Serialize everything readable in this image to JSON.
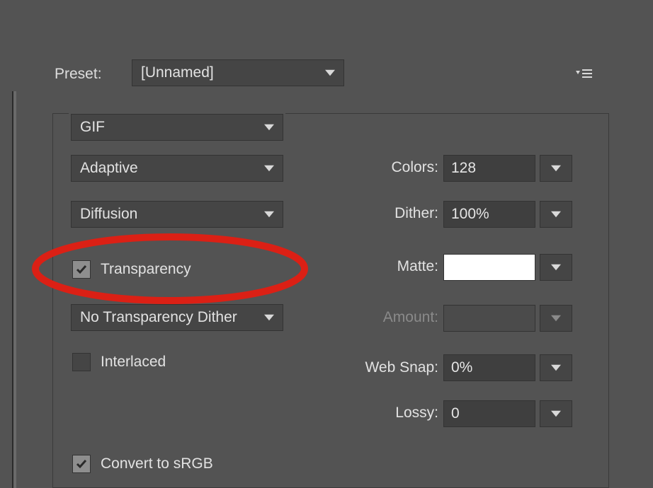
{
  "preset": {
    "label": "Preset:",
    "value": "[Unnamed]"
  },
  "format": {
    "value": "GIF"
  },
  "colorAlgo": {
    "value": "Adaptive"
  },
  "ditherAlgo": {
    "value": "Diffusion"
  },
  "transparency": {
    "label": "Transparency",
    "checked": true
  },
  "transparencyDither": {
    "value": "No Transparency Dither"
  },
  "interlaced": {
    "label": "Interlaced",
    "checked": false
  },
  "convertSrgb": {
    "label": "Convert to sRGB",
    "checked": true
  },
  "colors": {
    "label": "Colors:",
    "value": "128"
  },
  "dither": {
    "label": "Dither:",
    "value": "100%"
  },
  "matte": {
    "label": "Matte:",
    "swatch": "#ffffff"
  },
  "amount": {
    "label": "Amount:",
    "value": ""
  },
  "webSnap": {
    "label": "Web Snap:",
    "value": "0%"
  },
  "lossy": {
    "label": "Lossy:",
    "value": "0"
  }
}
